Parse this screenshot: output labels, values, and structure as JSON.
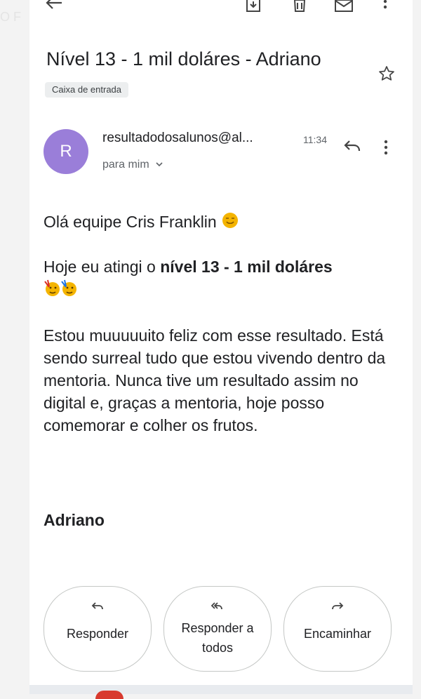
{
  "email": {
    "subject": "Nível 13 - 1 mil doláres - Adriano",
    "label": "Caixa de entrada",
    "sender": {
      "initial": "R",
      "address": "resultadodosalunos@al...",
      "time": "11:34",
      "recipient": "para mim"
    },
    "body": {
      "greeting": "Olá equipe Cris Franklin",
      "achievement_prefix": "Hoje eu atingi o ",
      "achievement_bold": "nível 13 - 1 mil doláres",
      "story": "Estou muuuuuito feliz com esse resultado. Está sendo surreal tudo que estou vivendo dentro da mentoria. Nunca tive um resultado assim no digital e, graças a mentoria, hoje posso comemorar e colher os frutos.",
      "signature": "Adriano"
    }
  },
  "actions": {
    "reply": "Responder",
    "reply_all": "Responder a todos",
    "forward": "Encaminhar"
  },
  "icons": {
    "back": "arrow-left-icon",
    "archive": "archive-icon",
    "delete": "trash-icon",
    "mark_unread": "mail-icon",
    "more": "more-vert-icon",
    "star": "star-icon",
    "reply": "reply-icon",
    "reply_all": "reply-all-icon",
    "forward": "forward-icon"
  },
  "colors": {
    "avatar": "#9a7ed9",
    "emoji": "#f4b400"
  }
}
